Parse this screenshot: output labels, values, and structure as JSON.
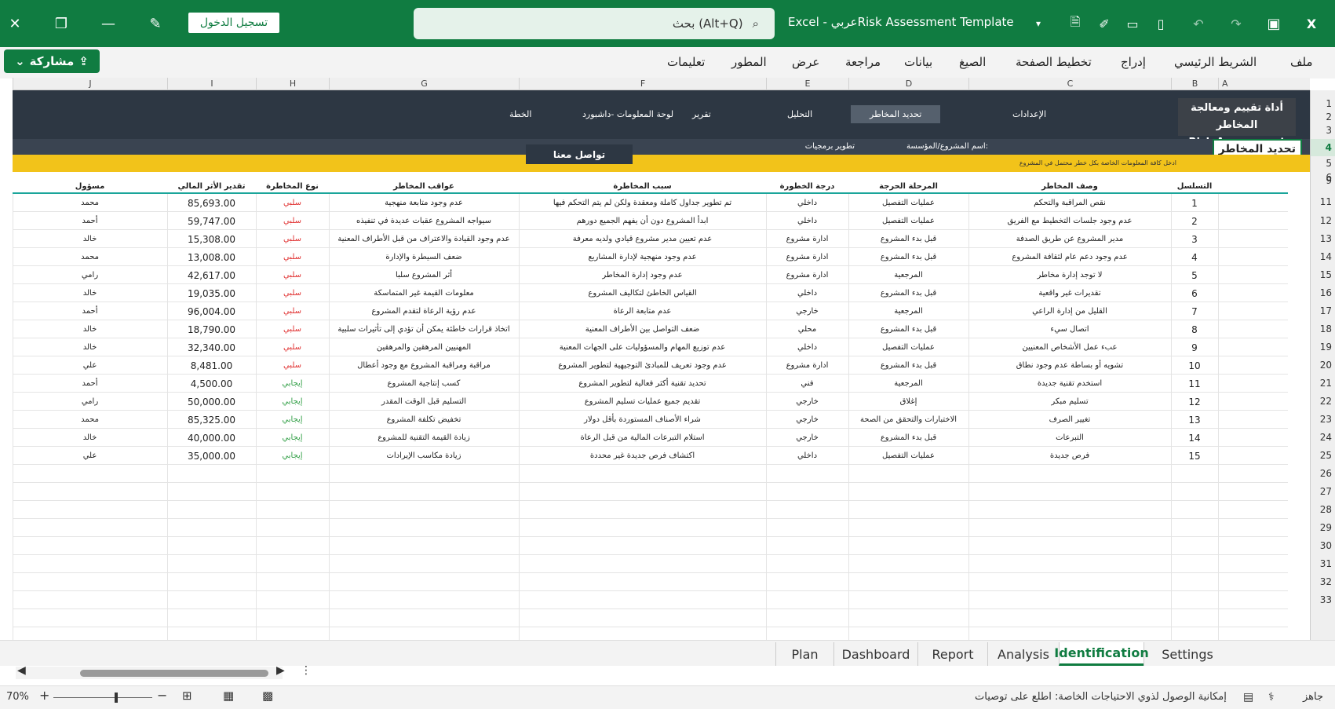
{
  "titlebar": {
    "signin": "تسجيل الدخول",
    "search_text": "بحث (Alt+Q)",
    "doc_title": "Excel  -  عربيRisk Assessment Template"
  },
  "ribbon": {
    "share": "مشاركة",
    "menus": [
      "ملف",
      "الشريط الرئيسي",
      "إدراج",
      "تخطيط الصفحة",
      "الصيغ",
      "بيانات",
      "مراجعة",
      "عرض",
      "المطور",
      "تعليمات"
    ]
  },
  "col_letters": [
    "J",
    "I",
    "H",
    "G",
    "F",
    "E",
    "D",
    "C",
    "B",
    "A"
  ],
  "row_numbers": [
    "1",
    "2",
    "3",
    "4",
    "5",
    "6",
    "9",
    "11",
    "12",
    "13",
    "14",
    "15",
    "16",
    "17",
    "18",
    "19",
    "20",
    "21",
    "22",
    "23",
    "24",
    "25",
    "26",
    "27",
    "28",
    "29",
    "30",
    "31",
    "32",
    "33"
  ],
  "banner": {
    "logo_line1": "أداة تقييم ومعالجة المخاطر",
    "logo_line2": "Risk Assessment",
    "nav": [
      "الإعدادات",
      "تحديد المخاطر",
      "التحليل",
      "تقرير",
      "لوحة المعلومات -داشبورد",
      "الخطة"
    ],
    "section_title": "تحديد المخاطر",
    "project_label": "اسم المشروع/المؤسسة:",
    "project_value": "تطوير برمجيات",
    "hint": "ادخل كافة المعلومات الخاصة بكل خطر محتمل في المشروع",
    "contact": "تواصل معنا"
  },
  "table": {
    "headers": [
      "التسلسل",
      "وصف المخاطر",
      "المرحلة الحرجة",
      "درجة الخطورة",
      "سبب المخاطرة",
      "عواقب المخاطر",
      "نوع المخاطرة",
      "تقدير الأثر المالي",
      "مسؤول"
    ],
    "rows": [
      [
        "1",
        "نقص المراقبة والتحكم",
        "عمليات التفصيل",
        "داخلي",
        "تم تطوير جداول كاملة ومعقدة ولكن لم يتم التحكم فيها",
        "عدم وجود متابعة منهجية",
        "سلبي",
        "85,693.00",
        "محمد"
      ],
      [
        "2",
        "عدم وجود جلسات التخطيط مع الفريق",
        "عمليات التفصيل",
        "داخلي",
        "ابدأ المشروع دون أن يفهم الجميع دورهم",
        "سيواجه المشروع عقبات عديدة في تنفيذه",
        "سلبي",
        "59,747.00",
        "أحمد"
      ],
      [
        "3",
        "مدير المشروع عن طريق الصدفة",
        "قبل بدء المشروع",
        "ادارة مشروع",
        "عدم تعيين مدير مشروع قيادي ولديه معرفة",
        "عدم وجود القيادة والاعتراف من قبل الأطراف المعنية",
        "سلبي",
        "15,308.00",
        "خالد"
      ],
      [
        "4",
        "عدم وجود دعم عام لثقافة المشروع",
        "قبل بدء المشروع",
        "ادارة مشروع",
        "عدم وجود منهجية لإدارة المشاريع",
        "ضعف السيطرة والإدارة",
        "سلبي",
        "13,008.00",
        "محمد"
      ],
      [
        "5",
        "لا توجد إدارة مخاطر",
        "المرجعية",
        "ادارة مشروع",
        "عدم وجود إدارة المخاطر",
        "أثر المشروع سلبا",
        "سلبي",
        "42,617.00",
        "رامي"
      ],
      [
        "6",
        "تقديرات غير واقعية",
        "قبل بدء المشروع",
        "داخلي",
        "القياس الخاطئ لتكاليف المشروع",
        "معلومات القيمة غير المتماسكة",
        "سلبي",
        "19,035.00",
        "خالد"
      ],
      [
        "7",
        "القليل من إدارة الراعي",
        "المرجعية",
        "خارجي",
        "عدم متابعة الرعاة",
        "عدم رؤية الرعاة لتقدم المشروع",
        "سلبي",
        "96,004.00",
        "أحمد"
      ],
      [
        "8",
        "اتصال سيء",
        "قبل بدء المشروع",
        "محلي",
        "ضعف التواصل بين الأطراف المعنية",
        "اتخاذ قرارات خاطئة يمكن أن تؤدي إلى تأثيرات سلبية",
        "سلبي",
        "18,790.00",
        "خالد"
      ],
      [
        "9",
        "عبء عمل الأشخاص المعنيين",
        "عمليات التفصيل",
        "داخلي",
        "عدم توزيع المهام والمسؤوليات على الجهات المعنية",
        "المهنيين المرهقين والمرهقين",
        "سلبي",
        "32,340.00",
        "خالد"
      ],
      [
        "10",
        "تشويه أو بساطة عدم وجود نطاق",
        "قبل بدء المشروع",
        "ادارة مشروع",
        "عدم وجود تعريف للمبادئ التوجيهية لتطوير المشروع",
        "مراقبة ومراقبة المشروع مع وجود أعطال",
        "سلبي",
        "8,481.00",
        "علي"
      ],
      [
        "11",
        "استخدم تقنية جديدة",
        "المرجعية",
        "فني",
        "تحديد تقنية أكثر فعالية لتطوير المشروع",
        "كسب إنتاجية المشروع",
        "إيجابي",
        "4,500.00",
        "أحمد"
      ],
      [
        "12",
        "تسليم مبكر",
        "إغلاق",
        "خارجي",
        "تقديم جميع عمليات تسليم المشروع",
        "التسليم قبل الوقت المقدر",
        "إيجابي",
        "50,000.00",
        "رامي"
      ],
      [
        "13",
        "تغيير الصرف",
        "الاختبارات والتحقق من الصحة",
        "خارجي",
        "شراء الأصناف المستوردة بأقل دولار",
        "تخفيض تكلفة المشروع",
        "إيجابي",
        "85,325.00",
        "محمد"
      ],
      [
        "14",
        "التبرعات",
        "قبل بدء المشروع",
        "خارجي",
        "استلام التبرعات المالية من قبل الرعاة",
        "زيادة القيمة التقنية للمشروع",
        "إيجابي",
        "40,000.00",
        "خالد"
      ],
      [
        "15",
        "فرص جديدة",
        "عمليات التفصيل",
        "داخلي",
        "اكتشاف فرص جديدة غير محددة",
        "زيادة مكاسب الإيرادات",
        "إيجابي",
        "35,000.00",
        "علي"
      ]
    ]
  },
  "tabs": [
    "Settings",
    "Identification",
    "Analysis",
    "Report",
    "Dashboard",
    "Plan"
  ],
  "active_tab": "Identification",
  "status": {
    "ready": "جاهز",
    "accessibility": "إمكانية الوصول لذوي الاحتياجات الخاصة: اطلع على توصيات",
    "zoom": "70%"
  },
  "colors": {
    "excel_green": "#107c41",
    "banner": "#2d3743",
    "yellow": "#f2c31a",
    "negative": "#e03131",
    "positive": "#2f9e44",
    "teal_line": "#1aa59a"
  }
}
